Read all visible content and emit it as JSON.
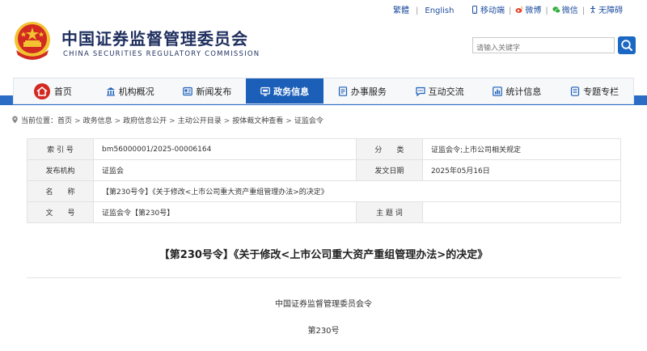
{
  "topbar": {
    "lang_traditional": "繁體",
    "lang_english": "English",
    "mobile": "移动端",
    "weibo": "微博",
    "wechat": "微信",
    "accessibility": "无障碍"
  },
  "header": {
    "title_cn": "中国证券监督管理委员会",
    "title_en": "CHINA SECURITIES REGULATORY COMMISSION",
    "search_placeholder": "请输入关键字"
  },
  "nav": {
    "items": [
      {
        "label": "首页",
        "icon": "home-icon"
      },
      {
        "label": "机构概况",
        "icon": "institution-icon"
      },
      {
        "label": "新闻发布",
        "icon": "news-icon"
      },
      {
        "label": "政务信息",
        "icon": "gov-info-icon",
        "active": true
      },
      {
        "label": "办事服务",
        "icon": "service-icon"
      },
      {
        "label": "互动交流",
        "icon": "interaction-icon"
      },
      {
        "label": "统计信息",
        "icon": "statistics-icon"
      },
      {
        "label": "专题专栏",
        "icon": "topic-icon"
      }
    ]
  },
  "breadcrumb": {
    "prefix": "当前位置：",
    "items": [
      "首页",
      "政务信息",
      "政府信息公开",
      "主动公开目录",
      "按体裁文种查看",
      "证监会令"
    ]
  },
  "meta": {
    "rows": [
      {
        "k1": "索 引 号",
        "v1": "bm56000001/2025-00006164",
        "k2": "分　　类",
        "v2": "证监会令;上市公司相关规定"
      },
      {
        "k1": "发布机构",
        "v1": "证监会",
        "k2": "发文日期",
        "v2": "2025年05月16日"
      },
      {
        "k1": "名　　称",
        "v1": "【第230号令】《关于修改<上市公司重大资产重组管理办法>的决定》"
      },
      {
        "k1": "文　　号",
        "v1": "证监会令【第230号】",
        "k2": "主 题 词",
        "v2": ""
      }
    ]
  },
  "article": {
    "title": "【第230号令】《关于修改<上市公司重大资产重组管理办法>的决定》",
    "line1": "中国证券监督管理委员会令",
    "line2": "第230号"
  },
  "colors": {
    "primary": "#1b5fb8",
    "nav_band": "#2b6cc4",
    "emblem_red": "#d22a22",
    "emblem_gold": "#f2c230"
  }
}
